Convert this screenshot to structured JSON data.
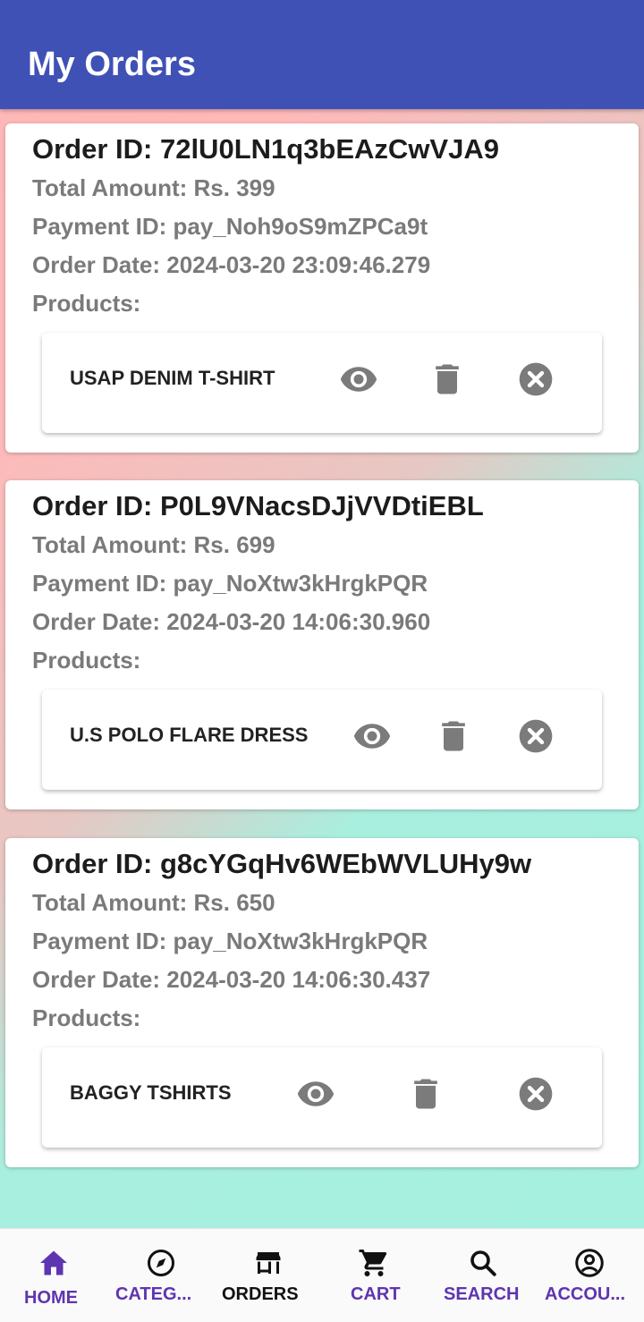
{
  "header": {
    "title": "My Orders"
  },
  "orders": [
    {
      "order_id": "Order ID: 72lU0LN1q3bEAzCwVJA9",
      "total": "Total Amount: Rs. 399",
      "payment": "Payment ID: pay_Noh9oS9mZPCa9t",
      "date": "Order Date: 2024-03-20 23:09:46.279",
      "products_label": "Products:",
      "products": [
        {
          "name": "USAP DENIM T-SHIRT"
        }
      ]
    },
    {
      "order_id": "Order ID: P0L9VNacsDJjVVDtiEBL",
      "total": "Total Amount: Rs. 699",
      "payment": "Payment ID: pay_NoXtw3kHrgkPQR",
      "date": "Order Date: 2024-03-20 14:06:30.960",
      "products_label": "Products:",
      "products": [
        {
          "name": "U.S POLO FLARE DRESS"
        }
      ]
    },
    {
      "order_id": "Order ID: g8cYGqHv6WEbWVLUHy9w",
      "total": "Total Amount: Rs. 650",
      "payment": "Payment ID: pay_NoXtw3kHrgkPQR",
      "date": "Order Date: 2024-03-20 14:06:30.437",
      "products_label": "Products:",
      "products": [
        {
          "name": "BAGGY TSHIRTS"
        }
      ]
    }
  ],
  "product_actions": {
    "view_icon": "eye-icon",
    "delete_icon": "trash-icon",
    "remove_icon": "close-circle-icon"
  },
  "bottom_nav": [
    {
      "label": "HOME",
      "icon": "home-icon",
      "active": true
    },
    {
      "label": "CATEG...",
      "icon": "compass-icon",
      "active": false
    },
    {
      "label": "ORDERS",
      "icon": "store-icon",
      "active": false
    },
    {
      "label": "CART",
      "icon": "cart-icon",
      "active": false
    },
    {
      "label": "SEARCH",
      "icon": "search-icon",
      "active": false
    },
    {
      "label": "ACCOU...",
      "icon": "account-circle-icon",
      "active": false
    }
  ],
  "colors": {
    "app_bar": "#3f51b5",
    "nav_purple": "#5e35b1",
    "nav_black": "#111111",
    "muted_text": "#7a7a7a",
    "icon_grey": "#7b7b7b"
  }
}
